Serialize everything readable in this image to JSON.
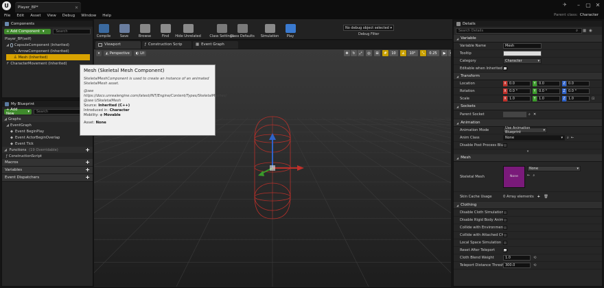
{
  "window": {
    "tab_title": "Player_BP*",
    "parent_class_label": "Parent class:",
    "parent_class_value": "Character",
    "menu": [
      "File",
      "Edit",
      "Asset",
      "View",
      "Debug",
      "Window",
      "Help"
    ]
  },
  "toolbar": {
    "buttons": [
      {
        "label": "Compile",
        "icon": "compile-icon",
        "color": "#3b6aa0"
      },
      {
        "label": "Save",
        "icon": "save-icon",
        "color": "#6a7ea0"
      },
      {
        "label": "Browse",
        "icon": "browse-icon",
        "color": "#888888"
      },
      {
        "label": "Find",
        "icon": "find-icon",
        "color": "#8c8c8c"
      },
      {
        "label": "Hide Unrelated",
        "icon": "hide-unrelated-icon",
        "color": "#8a8a8a"
      },
      {
        "label": "Class Settings",
        "icon": "class-settings-icon",
        "color": "#7a7a7a"
      },
      {
        "label": "Class Defaults",
        "icon": "class-defaults-icon",
        "color": "#7a7a7a"
      },
      {
        "label": "Simulation",
        "icon": "simulation-icon",
        "color": "#8a8a8a"
      },
      {
        "label": "Play",
        "icon": "play-icon",
        "color": "#3a7ad0"
      }
    ],
    "debug_select": "No debug object selected",
    "debug_filter": "Debug Filter"
  },
  "components_panel": {
    "title": "Components",
    "add_button": "+ Add Component",
    "search_placeholder": "Search",
    "items": [
      {
        "label": "Player_BP(self)"
      },
      {
        "label": "CapsuleComponent (Inherited)"
      },
      {
        "label": "ArrowComponent (Inherited)"
      },
      {
        "label": "Mesh (Inherited)"
      },
      {
        "label": "CharacterMovement (Inherited)"
      }
    ]
  },
  "blueprint_panel": {
    "title": "My Blueprint",
    "add_button": "+ Add New",
    "search_placeholder": "Search",
    "graphs_label": "Graphs",
    "event_graph": "EventGraph",
    "events": [
      "Event BeginPlay",
      "Event ActorBeginOverlap",
      "Event Tick"
    ],
    "functions_label": "Functions",
    "functions_count": "(19 Overridable)",
    "construction_script": "ConstructionScript",
    "macros": "Macros",
    "variables": "Variables",
    "dispatchers": "Event Dispatchers"
  },
  "editor_tabs": [
    "Viewport",
    "Construction Scrip",
    "Event Graph"
  ],
  "viewport": {
    "perspective": "Perspective",
    "lit": "Lit",
    "grid_snap": "10",
    "rot_snap": "10°",
    "scale_snap": "0.25",
    "cam_speed": "4"
  },
  "tooltip": {
    "title": "Mesh (Skeletal Mesh Component)",
    "desc": "SkeletalMeshComponent is used to create an instance of an animated SkeletalMesh asset.",
    "see1": "@see https://docs.unrealengine.com/latest/INT/Engine/Content/Types/SkeletalMeshes/",
    "see2": "@see USkeletalMesh",
    "source_label": "Source:",
    "source_value": "Inherited (C++)",
    "introduced_label": "Introduced in:",
    "introduced_value": "Character",
    "mobility_label": "Mobility:",
    "mobility_value": "Movable",
    "asset_label": "Asset:",
    "asset_value": "None"
  },
  "details": {
    "title": "Details",
    "search_placeholder": "Search Details",
    "variable": {
      "header": "Variable",
      "name_label": "Variable Name",
      "name_value": "Mesh",
      "tooltip_label": "Tooltip",
      "category_label": "Category",
      "category_value": "Character",
      "editable_label": "Editable when Inherited"
    },
    "transform": {
      "header": "Transform",
      "location_label": "Location",
      "location": [
        "0.0",
        "0.0",
        "0.0"
      ],
      "rotation_label": "Rotation",
      "rotation": [
        "0.0 °",
        "0.0 °",
        "0.0 °"
      ],
      "scale_label": "Scale",
      "scale": [
        "1.0",
        "1.0",
        "1.0"
      ]
    },
    "sockets": {
      "header": "Sockets",
      "parent_socket_label": "Parent Socket"
    },
    "animation": {
      "header": "Animation",
      "mode_label": "Animation Mode",
      "mode_value": "Use Animation Blueprint",
      "class_label": "Anim Class",
      "class_value": "None",
      "disable_pp_label": "Disable Post Process Bluep"
    },
    "mesh": {
      "header": "Mesh",
      "skeletal_label": "Skeletal Mesh",
      "skeletal_value": "None",
      "thumb_label": "None",
      "skin_cache_label": "Skin Cache Usage",
      "skin_cache_value": "0 Array elements"
    },
    "clothing": {
      "header": "Clothing",
      "items": [
        "Disable Cloth Simulation",
        "Disable Rigid Body Anim Nod",
        "Collide with Environment",
        "Collide with Attached Childre",
        "Local Space Simulation",
        "Reset After Teleport",
        "Cloth Blend Weight",
        "Teleport Distance Threshol"
      ],
      "checks": [
        false,
        false,
        false,
        false,
        false,
        true
      ],
      "blend_weight": "1.0",
      "teleport_threshold": "300.0"
    }
  },
  "colors": {
    "accent_orange": "#c8a000",
    "add_green": "#3f8a2c",
    "selection": "#d8a200",
    "thumb_purple": "#7a1a7a",
    "axis_x": "#c0302a",
    "axis_y": "#3a9a2a",
    "axis_z": "#2f62c8"
  }
}
